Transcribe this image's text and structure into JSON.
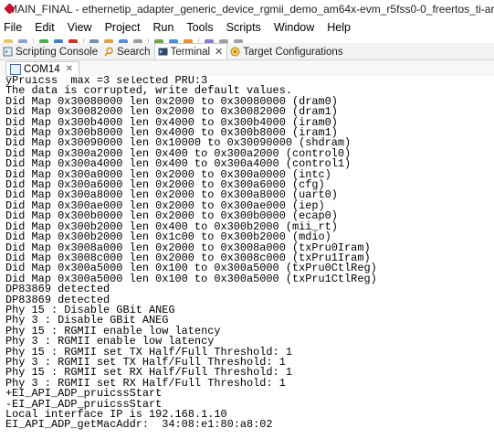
{
  "window": {
    "title": "MAIN_FINAL - ethernetip_adapter_generic_device_rgmii_demo_am64x-evm_r5fss0-0_freertos_ti-arm-clang/app.c - Code Composer Stu"
  },
  "menu": [
    "File",
    "Edit",
    "View",
    "Project",
    "Run",
    "Tools",
    "Scripts",
    "Window",
    "Help"
  ],
  "views": [
    {
      "label": "Scripting Console",
      "icon": "script-icon",
      "active": false
    },
    {
      "label": "Search",
      "icon": "search-icon",
      "active": false
    },
    {
      "label": "Terminal",
      "icon": "terminal-icon",
      "active": true
    },
    {
      "label": "Target Configurations",
      "icon": "target-icon",
      "active": false
    }
  ],
  "terminal_tab": {
    "label": "COM14"
  },
  "console_lines": [
    "ÿPruicss  max =3 selected PRU:3",
    "The data is corrupted, write default values.",
    "Did Map 0x30080000 len 0x2000 to 0x30080000 (dram0)",
    "Did Map 0x30082000 len 0x2000 to 0x30082000 (dram1)",
    "Did Map 0x300b4000 len 0x4000 to 0x300b4000 (iram0)",
    "Did Map 0x300b8000 len 0x4000 to 0x300b8000 (iram1)",
    "Did Map 0x30090000 len 0x10000 to 0x30090000 (shdram)",
    "Did Map 0x300a2000 len 0x400 to 0x300a2000 (control0)",
    "Did Map 0x300a4000 len 0x400 to 0x300a4000 (control1)",
    "Did Map 0x300a0000 len 0x2000 to 0x300a0000 (intc)",
    "Did Map 0x300a6000 len 0x2000 to 0x300a6000 (cfg)",
    "Did Map 0x300a8000 len 0x2000 to 0x300a8000 (uart0)",
    "Did Map 0x300ae000 len 0x2000 to 0x300ae000 (iep)",
    "Did Map 0x300b0000 len 0x2000 to 0x300b0000 (ecap0)",
    "Did Map 0x300b2000 len 0x400 to 0x300b2000 (mii_rt)",
    "Did Map 0x300b2000 len 0x1c00 to 0x300b2000 (mdio)",
    "Did Map 0x3008a000 len 0x2000 to 0x3008a000 (txPru0Iram)",
    "Did Map 0x3008c000 len 0x2000 to 0x3008c000 (txPru1Iram)",
    "Did Map 0x300a5000 len 0x100 to 0x300a5000 (txPru0CtlReg)",
    "Did Map 0x300a5000 len 0x100 to 0x300a5000 (txPru1CtlReg)",
    "DP83869 detected",
    "DP83869 detected",
    "Phy 15 : Disable GBit ANEG",
    "Phy 3 : Disable GBit ANEG",
    "Phy 15 : RGMII enable low latency",
    "Phy 3 : RGMII enable low latency",
    "Phy 15 : RGMII set TX Half/Full Threshold: 1",
    "Phy 3 : RGMII set TX Half/Full Threshold: 1",
    "Phy 15 : RGMII set RX Half/Full Threshold: 1",
    "Phy 3 : RGMII set RX Half/Full Threshold: 1",
    "+EI_API_ADP_pruicssStart",
    "-EI_API_ADP_pruicssStart",
    "Local interface IP is 192.168.1.10",
    "EI_API_ADP_getMacAddr:  34:08:e1:80:a8:02"
  ],
  "colors": {
    "app_icon": "#c8102e",
    "terminal_tab_icon": "#3a6ea5"
  }
}
